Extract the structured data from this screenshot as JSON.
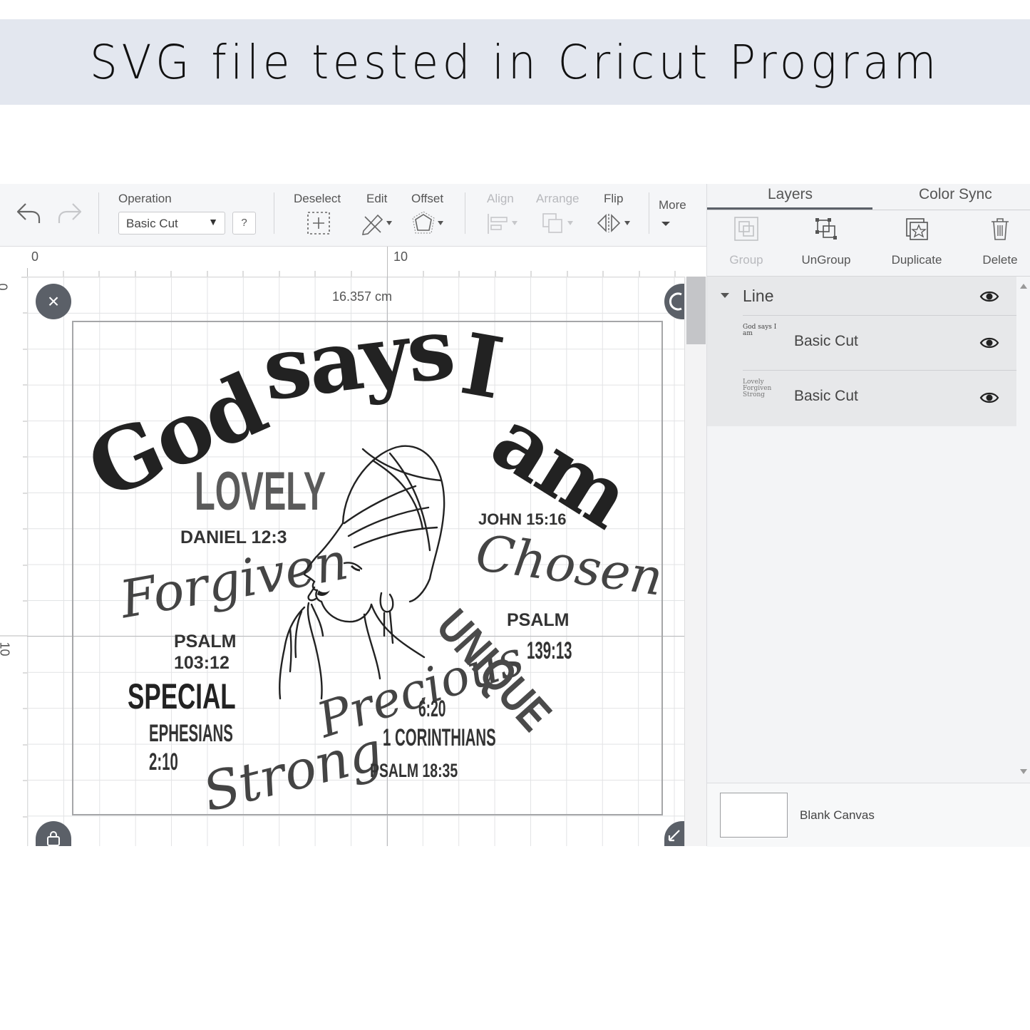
{
  "banner": {
    "title": "SVG file tested in Cricut Program"
  },
  "toolbar": {
    "operation_label": "Operation",
    "operation_value": "Basic Cut",
    "help_label": "?",
    "deselect_label": "Deselect",
    "edit_label": "Edit",
    "offset_label": "Offset",
    "align_label": "Align",
    "arrange_label": "Arrange",
    "flip_label": "Flip",
    "more_label": "More"
  },
  "canvas": {
    "ruler_top": [
      "0",
      "10"
    ],
    "ruler_left": [
      "0",
      "10"
    ],
    "width_readout": "16.357 cm",
    "close_handle": "×"
  },
  "design": {
    "headline": [
      "God",
      "says",
      "I",
      "am"
    ],
    "words": {
      "lovely": "LOVELY",
      "daniel": "DANIEL 12:3",
      "forgiven": "Forgiven",
      "psalm103_a": "PSALM",
      "psalm103_b": "103:12",
      "special": "SPECIAL",
      "ephesians": "EPHESIANS",
      "eph_ref": "2:10",
      "strong": "Strong",
      "precious": "Precious",
      "cor_ref": "6:20",
      "corinthians": "1 CORINTHIANS",
      "psalm1835": "PSALM 18:35",
      "john": "JOHN 15:16",
      "chosen": "Chosen",
      "psalm139_a": "PSALM",
      "psalm139_b": "139:13",
      "unique": "UNIQUE"
    }
  },
  "panel": {
    "tabs": [
      "Layers",
      "Color Sync"
    ],
    "actions": {
      "group": "Group",
      "ungroup": "UnGroup",
      "duplicate": "Duplicate",
      "delete": "Delete"
    },
    "group_name": "Line",
    "layers": [
      {
        "name": "Basic Cut",
        "thumb": "God says I am"
      },
      {
        "name": "Basic Cut",
        "thumb": "Lovely Forgiven Strong"
      }
    ],
    "canvas_label": "Blank Canvas"
  },
  "colors": {
    "accent": "#5b6068",
    "banner_bg": "#e3e7ef",
    "toolbar_bg": "#f5f6f8",
    "panel_bg": "#f3f4f6"
  }
}
